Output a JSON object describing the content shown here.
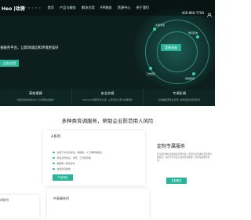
{
  "nav": {
    "logo_text": "Heo |动测",
    "logo_sub": "H R C E O",
    "items": [
      "首页",
      "产品与服务",
      "解决方案",
      "API服务",
      "资源中心",
      "关于我们"
    ],
    "phone": "400-860-7700",
    "icon": "user-icon"
  },
  "hero": {
    "text": "查服务平台，让职场诚信和环境更美好",
    "button": "立即试用",
    "core_badge": "背景调查",
    "node_labels": [
      "背调专家",
      "学历查询",
      "工作经历",
      "风险核查"
    ]
  },
  "features": [
    {
      "title": "高效便捷",
      "desc": "标准化报告快速交付 | 全流程在线操作"
    },
    {
      "title": "安全合规",
      "desc": "ISO27001国际安全认证 | 公安部信息安全等级保护"
    },
    {
      "title": "专调反馈",
      "desc": "权威数据源专业背调 | 报告逐项反馈更及时"
    }
  ],
  "section": {
    "title": "多种类背调服务，帮助企业防范用人风险"
  },
  "card_standard": {
    "title": "A系列",
    "items": [
      "适用于中基层岗位，职能类，IT工程师等职位",
      "核查身份信息，学历，工作经历等",
      "数据库+核实查询",
      "快速出具报告"
    ],
    "button": "产品详情"
  },
  "custom": {
    "title": "定制专属服务",
    "desc": "针对特定岗位定制专属背调方案，按照企业需求灵活配置背调项目，满足不同行业企业的背调需求，提供专属服务顾问。",
    "button": "定制服务"
  },
  "bottom_labels": {
    "left": "A系列",
    "middle": "中高端系列"
  },
  "colors": {
    "accent": "#2bb39a",
    "hero_bg": "#0c1f1d"
  }
}
